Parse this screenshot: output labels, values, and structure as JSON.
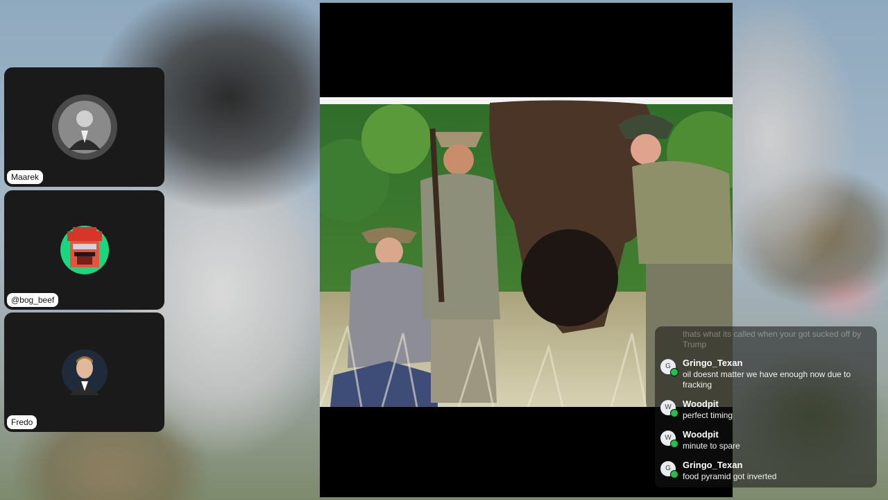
{
  "participants": [
    {
      "name": "Maarek",
      "avatar_icon": "vintage-man-portrait-icon"
    },
    {
      "name": "@bog_beef",
      "avatar_icon": "pixel-mustache-man-icon"
    },
    {
      "name": "Fredo",
      "avatar_icon": "man-portrait-icon"
    }
  ],
  "stage": {
    "content": "hunting-photo"
  },
  "chat": {
    "faded_message": "thats what its called when your got sucked off by Trump",
    "messages": [
      {
        "user": "Gringo_Texan",
        "initial": "G",
        "text": "oil doesnt matter we have enough now due to fracking"
      },
      {
        "user": "Woodpit",
        "initial": "W",
        "text": "perfect timing"
      },
      {
        "user": "Woodpit",
        "initial": "W",
        "text": "minute to spare"
      },
      {
        "user": "Gringo_Texan",
        "initial": "G",
        "text": "food pyramid got inverted"
      }
    ]
  },
  "colors": {
    "tile_bg": "#1a1a1a",
    "badge": "#1cc54a"
  }
}
